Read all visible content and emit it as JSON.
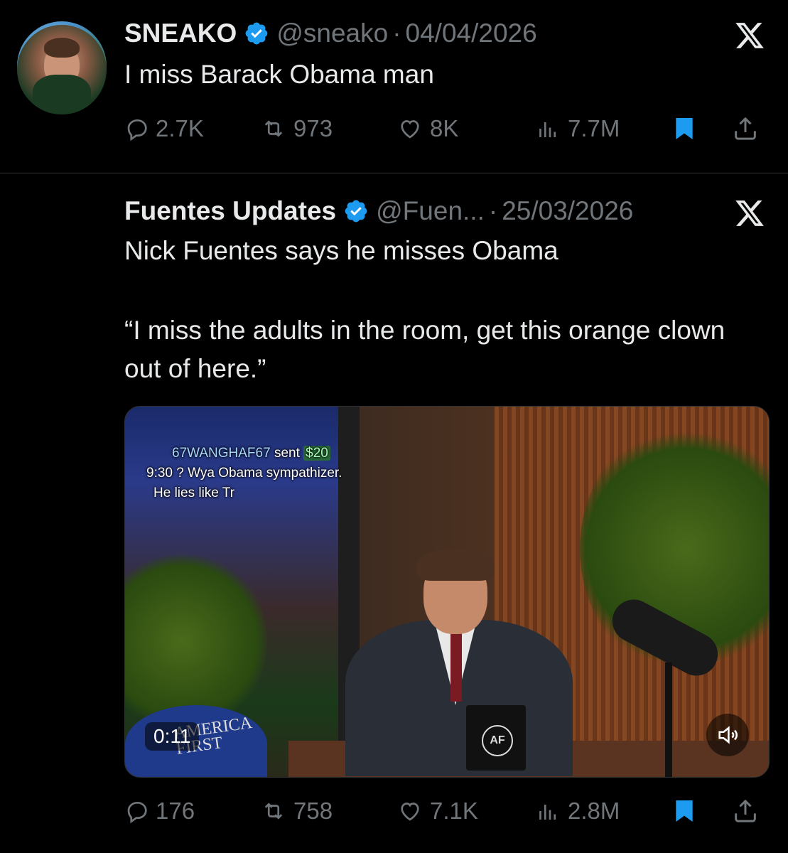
{
  "tweets": [
    {
      "name": "SNEAKO",
      "handle": "@sneako",
      "separator": "·",
      "date": "04/04/2026",
      "text": "I miss Barack Obama man",
      "replies": "2.7K",
      "reposts": "973",
      "likes": "8K",
      "views": "7.7M",
      "bookmarked": true
    },
    {
      "name": "Fuentes Updates",
      "handle": "@Fuen...",
      "separator": "·",
      "date": "25/03/2026",
      "text_line1": "Nick Fuentes says he misses Obama",
      "text_line2": "“I miss the adults in the room, get this orange clown out of here.”",
      "replies": "176",
      "reposts": "758",
      "likes": "7.1K",
      "views": "2.8M",
      "bookmarked": true,
      "video": {
        "chat_sender": "67WANGHAF67",
        "chat_sent": "sent",
        "chat_amount": "$20",
        "chat_line2": "9:30 ? Wya Obama sympathizer.",
        "chat_line3": "He lies like Tr",
        "timestamp": "0:11",
        "cap_text": "AMERICA FIRST",
        "mug_text": "AF"
      }
    }
  ],
  "colors": {
    "background": "#000000",
    "text": "#e7e9ea",
    "muted": "#71767b",
    "verified": "#1d9bf0",
    "bookmark": "#1d9bf0"
  },
  "icons": [
    "verified-badge-icon",
    "x-logo-icon",
    "reply-icon",
    "repost-icon",
    "like-icon",
    "views-icon",
    "bookmark-icon",
    "share-icon",
    "volume-icon"
  ]
}
